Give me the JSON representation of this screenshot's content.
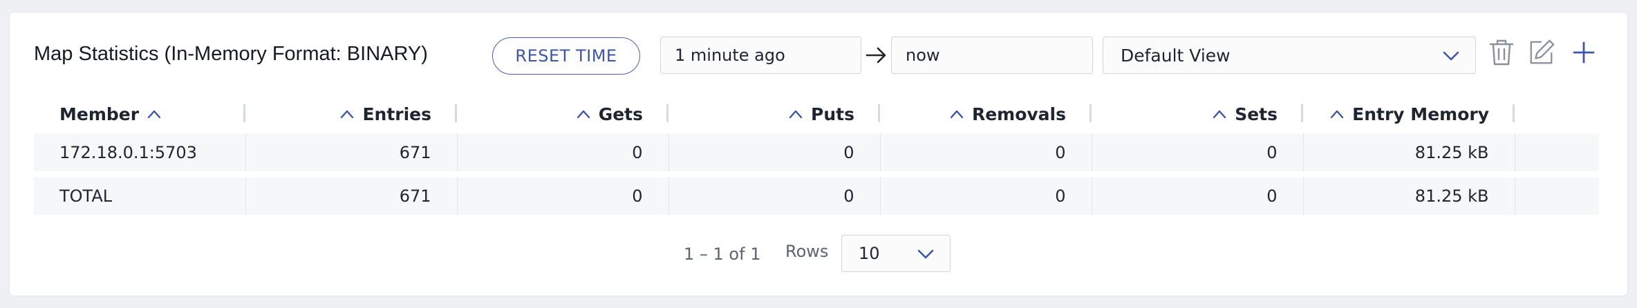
{
  "panel": {
    "title": "Map Statistics (In-Memory Format: BINARY)",
    "reset_label": "RESET TIME",
    "from_value": "1 minute ago",
    "to_value": "now",
    "view_value": "Default View",
    "accent_color": "#3c55a8"
  },
  "table": {
    "columns": [
      "Member",
      "Entries",
      "Gets",
      "Puts",
      "Removals",
      "Sets",
      "Entry Memory"
    ],
    "rows": [
      [
        "172.18.0.1:5703",
        "671",
        "0",
        "0",
        "0",
        "0",
        "81.25 kB"
      ],
      [
        "TOTAL",
        "671",
        "0",
        "0",
        "0",
        "0",
        "81.25 kB"
      ]
    ]
  },
  "pagination": {
    "range": "1 – 1 of 1",
    "rows_label": "Rows",
    "rows_value": "10"
  },
  "icons": [
    "arrow-right-icon",
    "chevron-down-icon",
    "trash-icon",
    "edit-icon",
    "plus-icon",
    "sort-up-icon"
  ]
}
